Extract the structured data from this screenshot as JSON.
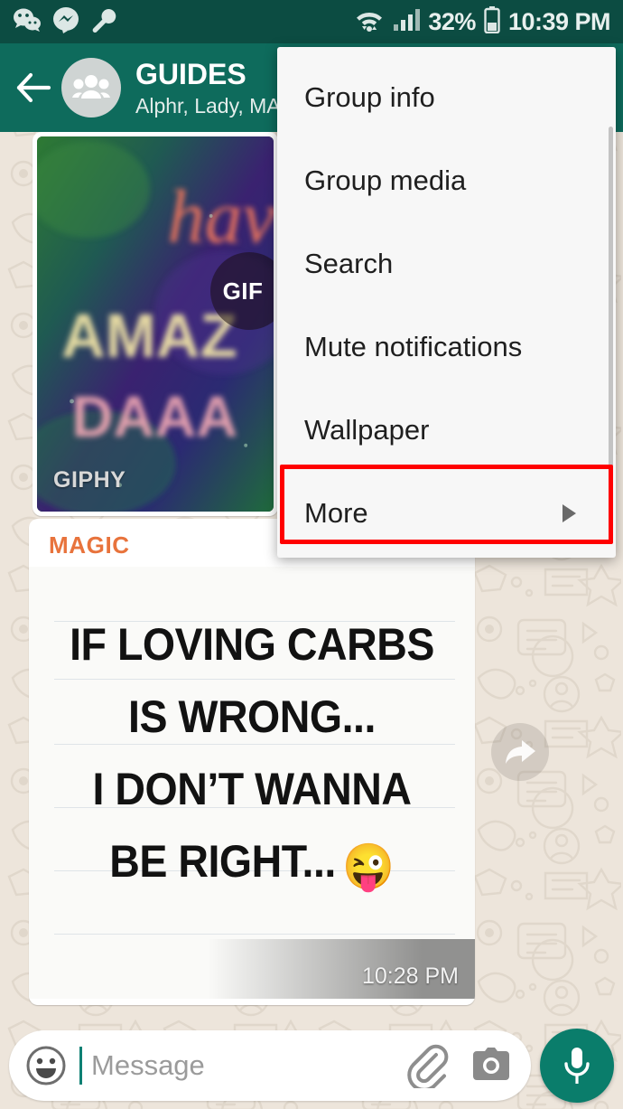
{
  "status_bar": {
    "app_icons": [
      "wechat-icon",
      "messenger-icon",
      "wrench-icon"
    ],
    "wifi_icon": "wifi-icon",
    "signal_icon": "cellular-signal-icon",
    "battery_percent": "32%",
    "battery_icon": "battery-icon",
    "clock": "10:39 PM",
    "background_color": "#0C4C42"
  },
  "app_bar": {
    "back_icon": "back-arrow-icon",
    "avatar_icon": "group-avatar-icon",
    "title": "GUIDES",
    "subtitle": "Alphr, Lady, MA",
    "background_color": "#0E6B5C"
  },
  "overflow_menu": {
    "items": [
      {
        "label": "Group info",
        "has_submenu": false
      },
      {
        "label": "Group media",
        "has_submenu": false
      },
      {
        "label": "Search",
        "has_submenu": false
      },
      {
        "label": "Mute notifications",
        "has_submenu": false
      },
      {
        "label": "Wallpaper",
        "has_submenu": false
      },
      {
        "label": "More",
        "has_submenu": true
      }
    ],
    "highlighted_item": "More",
    "highlight_color": "#FF0000",
    "background_color": "#F7F7F7",
    "submenu_arrow_icon": "triangle-right-icon"
  },
  "messages": {
    "gif_message": {
      "badge_label": "GIF",
      "watermark": "GIPHY",
      "gif_text_line1": "have",
      "gif_text_line2": "AMAZ",
      "gif_text_line3": "DAAA"
    },
    "meme_message": {
      "sender": "MAGIC",
      "sender_color": "#E8733C",
      "line1": "IF LOVING CARBS",
      "line2": "IS WRONG...",
      "line3": "I DON’T WANNA",
      "line4": "BE RIGHT...",
      "emoji": "😜",
      "timestamp": "10:28 PM"
    },
    "forward_icon": "forward-arrow-icon"
  },
  "input_bar": {
    "emoji_icon": "emoji-smiley-icon",
    "placeholder": "Message",
    "attach_icon": "paperclip-icon",
    "camera_icon": "camera-icon",
    "mic_icon": "microphone-icon",
    "mic_button_color": "#0A7D6B"
  }
}
